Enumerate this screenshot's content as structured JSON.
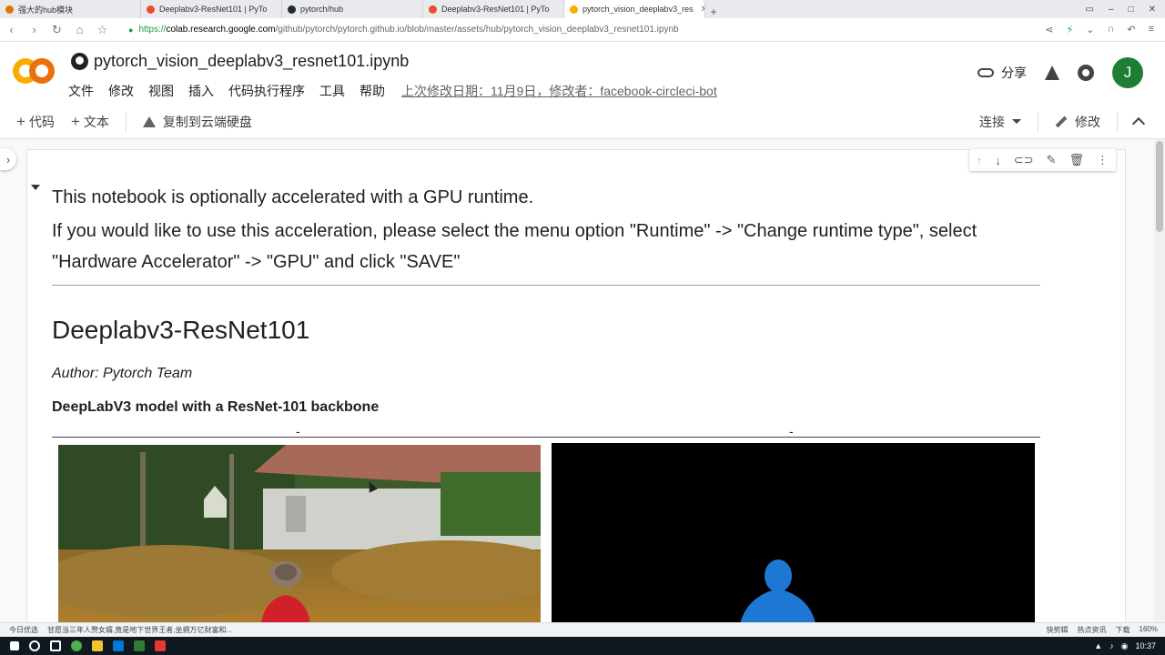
{
  "browser": {
    "tabs": [
      {
        "label": "强大的hub模块",
        "color": "#e37400"
      },
      {
        "label": "Deeplabv3-ResNet101 | PyTo",
        "color": "#ee4c2c"
      },
      {
        "label": "pytorch/hub",
        "color": "#24292e"
      },
      {
        "label": "Deeplabv3-ResNet101 | PyTo",
        "color": "#ee4c2c"
      },
      {
        "label": "pytorch_vision_deeplabv3_res",
        "color": "#f9ab00"
      }
    ],
    "url": {
      "proto": "https://",
      "host": "colab.research.google.com",
      "path": "/github/pytorch/pytorch.github.io/blob/master/assets/hub/pytorch_vision_deeplabv3_resnet101.ipynb"
    }
  },
  "colab": {
    "title": "pytorch_vision_deeplabv3_resnet101.ipynb",
    "menu": [
      "文件",
      "修改",
      "视图",
      "插入",
      "代码执行程序",
      "工具",
      "帮助"
    ],
    "last_edit": "上次修改日期：11月9日，修改者：facebook-circleci-bot",
    "share": "分享",
    "avatar_letter": "J"
  },
  "toolbar": {
    "code": "代码",
    "text": "文本",
    "copy_to_drive": "复制到云端硬盘",
    "connect": "连接",
    "edit": "修改"
  },
  "cell": {
    "p1": "This notebook is optionally accelerated with a GPU runtime.",
    "p2": "If you would like to use this acceleration, please select the menu option \"Runtime\" -> \"Change runtime type\", select \"Hardware Accelerator\" -> \"GPU\" and click \"SAVE\"",
    "heading": "Deeplabv3-ResNet101",
    "author": "Author: Pytorch Team",
    "subtitle": "DeepLabV3 model with a ResNet-101 backbone",
    "table_headers": [
      "-",
      "-"
    ]
  },
  "statusbar": {
    "left1": "今日优选",
    "left2": "甘愿当三年人赘女婿,竟是地下世界王者,坐拥万亿财富和...",
    "right": [
      "快剪辑",
      "热点资讯",
      "下载",
      "160%"
    ]
  },
  "taskbar": {
    "time": "10:37"
  },
  "colors": {
    "colab_orange": "#f9ab00",
    "avatar_green": "#1e7e34",
    "segmentation_blue": "#1f77d4"
  }
}
